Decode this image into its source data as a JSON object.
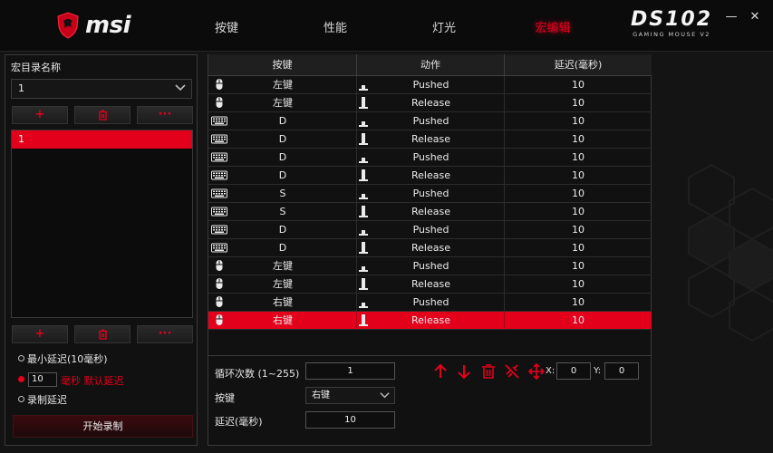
{
  "header": {
    "brand": "msi",
    "tabs": [
      {
        "label": "按键",
        "active": false
      },
      {
        "label": "性能",
        "active": false
      },
      {
        "label": "灯光",
        "active": false
      },
      {
        "label": "宏编辑",
        "active": true
      }
    ],
    "product_name": "DS102",
    "product_sub": "GAMING MOUSE V2",
    "minimize_label": "—",
    "close_label": "✕"
  },
  "left": {
    "title": "宏目录名称",
    "selected_macro": "1",
    "buttons": {
      "add": "+",
      "delete_icon": "trash-icon",
      "more": "···"
    },
    "macros": [
      "1"
    ],
    "options": {
      "min_delay": "最小延迟(10毫秒)",
      "default_delay_value": "10",
      "default_delay_label": "毫秒 默认延迟",
      "record_delay": "录制延迟",
      "selected": "default"
    },
    "record_button": "开始录制"
  },
  "table": {
    "headers": [
      "按键",
      "动作",
      "延迟(毫秒)"
    ],
    "rows": [
      {
        "device": "mouse",
        "key": "左键",
        "action": "Pushed",
        "delay": "10"
      },
      {
        "device": "mouse",
        "key": "左键",
        "action": "Release",
        "delay": "10"
      },
      {
        "device": "keyboard",
        "key": "D",
        "action": "Pushed",
        "delay": "10"
      },
      {
        "device": "keyboard",
        "key": "D",
        "action": "Release",
        "delay": "10"
      },
      {
        "device": "keyboard",
        "key": "D",
        "action": "Pushed",
        "delay": "10"
      },
      {
        "device": "keyboard",
        "key": "D",
        "action": "Release",
        "delay": "10"
      },
      {
        "device": "keyboard",
        "key": "S",
        "action": "Pushed",
        "delay": "10"
      },
      {
        "device": "keyboard",
        "key": "S",
        "action": "Release",
        "delay": "10"
      },
      {
        "device": "keyboard",
        "key": "D",
        "action": "Pushed",
        "delay": "10"
      },
      {
        "device": "keyboard",
        "key": "D",
        "action": "Release",
        "delay": "10"
      },
      {
        "device": "mouse",
        "key": "左键",
        "action": "Pushed",
        "delay": "10"
      },
      {
        "device": "mouse",
        "key": "左键",
        "action": "Release",
        "delay": "10"
      },
      {
        "device": "mouse",
        "key": "右键",
        "action": "Pushed",
        "delay": "10"
      },
      {
        "device": "mouse",
        "key": "右键",
        "action": "Release",
        "delay": "10",
        "selected": true
      }
    ]
  },
  "editor": {
    "loop_label": "循环次数 (1~255)",
    "loop_value": "1",
    "key_label": "按键",
    "key_value": "右键",
    "delay_label": "延迟(毫秒)",
    "delay_value": "10",
    "tools": [
      "arrow-up-icon",
      "arrow-down-icon",
      "trash-icon",
      "no-link-icon",
      "move-icon"
    ],
    "x_label": "X:",
    "x_value": "0",
    "y_label": "Y:",
    "y_value": "0"
  },
  "colors": {
    "accent": "#e3001b",
    "background": "#141414",
    "panel": "#111111"
  }
}
